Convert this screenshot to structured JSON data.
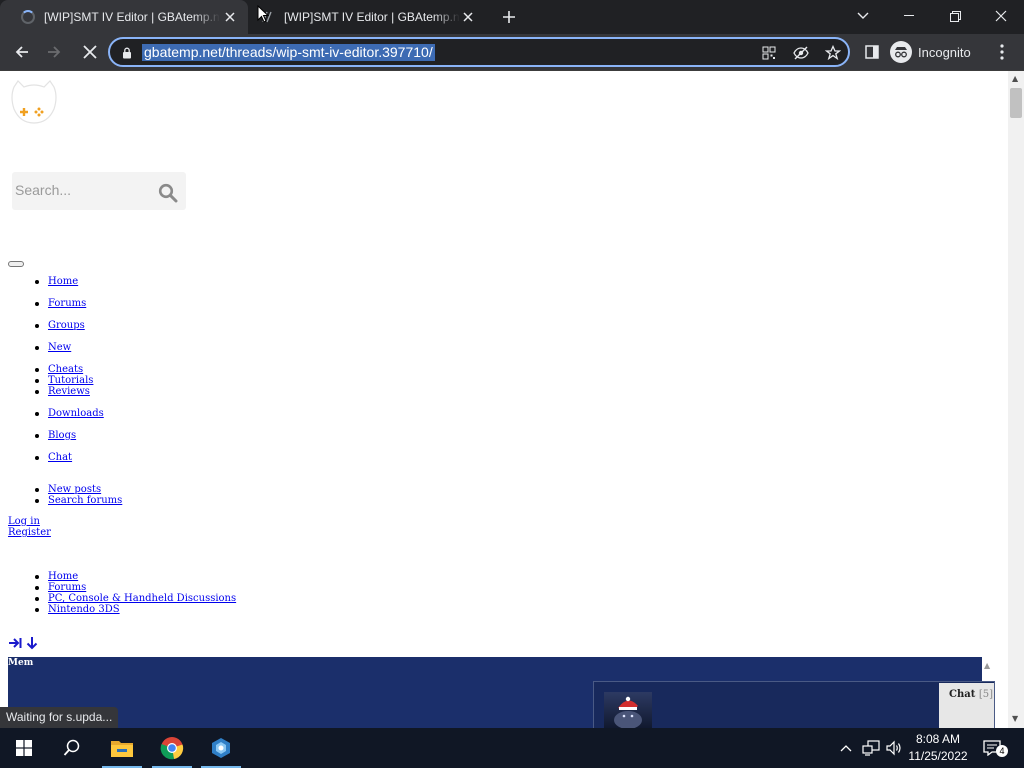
{
  "browser": {
    "tabs": [
      {
        "title": "[WIP]SMT IV Editor | GBAtemp.net",
        "loading": true,
        "active": true
      },
      {
        "title": "[WIP]SMT IV Editor | GBAtemp.net",
        "loading": false,
        "active": false
      }
    ],
    "url": "gbatemp.net/threads/wip-smt-iv-editor.397710/",
    "profile_label": "Incognito",
    "status_text": "Waiting for s.upda..."
  },
  "page": {
    "search": {
      "placeholder": "Search..."
    },
    "nav": [
      "Home",
      "Forums",
      "Groups",
      "New",
      "Cheats",
      "Tutorials",
      "Reviews",
      "Downloads",
      "Blogs",
      "Chat"
    ],
    "sub_nav": [
      "New posts",
      "Search forums"
    ],
    "auth": {
      "login": "Log in",
      "register": "Register"
    },
    "breadcrumbs": [
      "Home",
      "Forums",
      "PC, Console & Handheld Discussions",
      "Nintendo 3DS"
    ],
    "banner_label": "Mem",
    "chat": {
      "label": "Chat",
      "count": "[5]"
    }
  },
  "taskbar": {
    "time": "8:08 AM",
    "date": "11/25/2022",
    "notification_count": "4"
  },
  "colors": {
    "accent": "#8ab4f8",
    "banner": "#1b2f6b",
    "link": "#0000ee"
  }
}
